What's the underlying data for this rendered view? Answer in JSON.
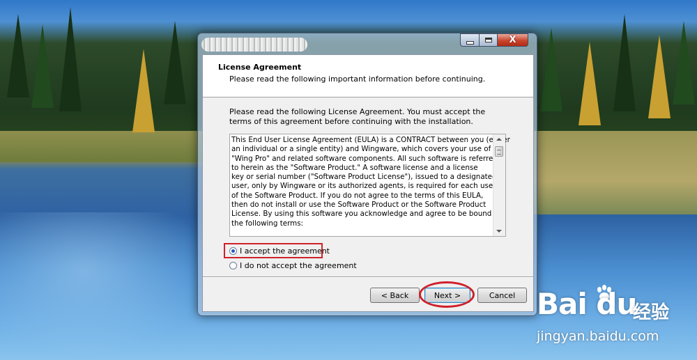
{
  "window": {
    "header_title": "License Agreement",
    "header_subtitle": "Please read the following important information before continuing.",
    "close_glyph": "X"
  },
  "intro_text": "Please read the following License Agreement. You must accept the terms of this agreement before continuing with the installation.",
  "eula_lines": [
    "This End User License Agreement (EULA) is a CONTRACT between you (either",
    "an individual or a single entity) and Wingware, which covers your use of",
    "\"Wing Pro\" and related software components.  All such software is referred",
    "to herein as the \"Software Product.\"  A software license and a license",
    "key or serial number (\"Software Product License\"), issued to a designated",
    "user, only by Wingware or its authorized agents, is required for each user",
    "of the Software Product. If you do not agree to the terms of this EULA,",
    "then do not install or use the Software Product or the Software Product",
    "License. By using this software you acknowledge and agree to be bound by",
    "the following terms:"
  ],
  "radios": {
    "accept": "I accept the agreement",
    "decline": "I do not accept the agreement",
    "selected": "accept"
  },
  "buttons": {
    "back": "< Back",
    "next": "Next >",
    "cancel": "Cancel"
  },
  "watermark": {
    "logo": "Bai du",
    "cn": "经验",
    "url": "jingyan.baidu.com"
  },
  "colors": {
    "highlight": "#d0202a",
    "close_button": "#c7452d"
  }
}
